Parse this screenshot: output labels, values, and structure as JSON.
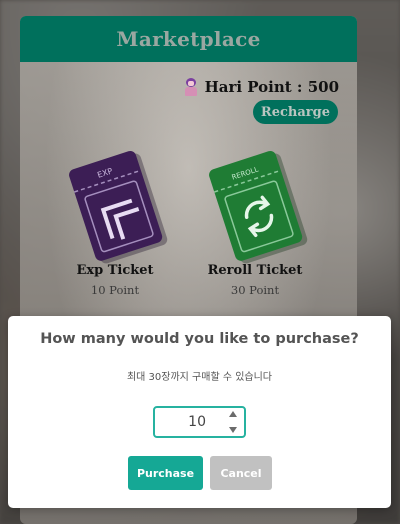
{
  "marketplace": {
    "title": "Marketplace",
    "points_label": "Hari Point : 500",
    "recharge_label": "Recharge",
    "tickets": [
      {
        "name": "Exp Ticket",
        "price": "10 Point",
        "stub_text": "EXP",
        "color": "#3c1e55",
        "icon": "double-chevron-up-left-icon"
      },
      {
        "name": "Reroll Ticket",
        "price": "30 Point",
        "stub_text": "REROLL",
        "color": "#1f7c34",
        "icon": "refresh-icon"
      }
    ]
  },
  "purchase_modal": {
    "title": "How many would you like to purchase?",
    "subtitle": "최대 30장까지 구매할 수 있습니다",
    "quantity": "10",
    "purchase_label": "Purchase",
    "cancel_label": "Cancel",
    "accent_color": "#15a895",
    "cancel_color": "#c1c1c1"
  }
}
